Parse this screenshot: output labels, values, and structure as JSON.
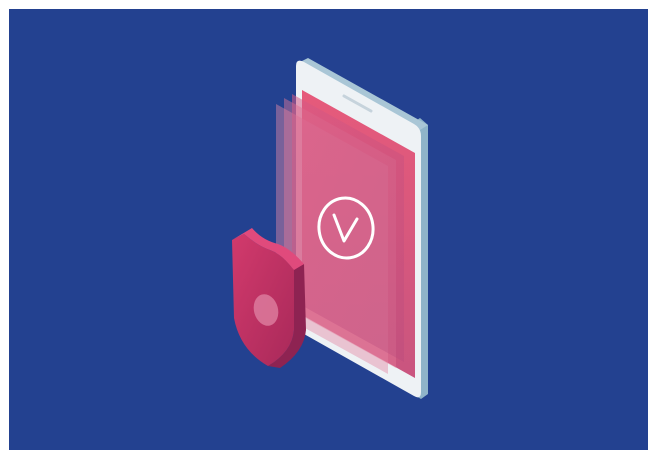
{
  "scene": {
    "background_color": "#234190",
    "frame_color": "#ffffff",
    "phone_body_color": "#e9eef2",
    "phone_edge_color": "#8fb4c9",
    "screen_color": "#e5567a",
    "shield_color": "#c43467",
    "checkmark_color": "#ffffff",
    "icons": [
      "smartphone-icon",
      "checkmark-circle-icon",
      "shield-icon"
    ]
  }
}
